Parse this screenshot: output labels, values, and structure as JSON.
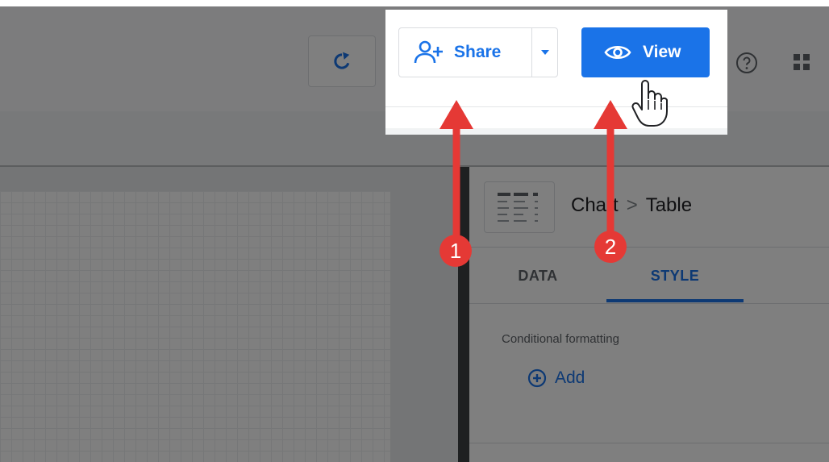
{
  "toolbar": {
    "refresh_icon": "refresh-icon",
    "share_label": "Share",
    "share_icon": "person-add-icon",
    "share_dropdown_icon": "caret-down-icon",
    "view_label": "View",
    "view_icon": "eye-icon",
    "help_icon": "help-circle-icon",
    "apps_icon": "apps-grid-icon"
  },
  "panel": {
    "breadcrumb": {
      "parent": "Chart",
      "separator": ">",
      "current": "Table"
    },
    "tabs": [
      {
        "label": "DATA",
        "active": false
      },
      {
        "label": "STYLE",
        "active": true
      }
    ],
    "section_label": "Conditional formatting",
    "add_label": "Add"
  },
  "annotations": {
    "marker_1": "1",
    "marker_2": "2"
  },
  "colors": {
    "accent": "#1a73e8",
    "annotation": "#e53935"
  }
}
